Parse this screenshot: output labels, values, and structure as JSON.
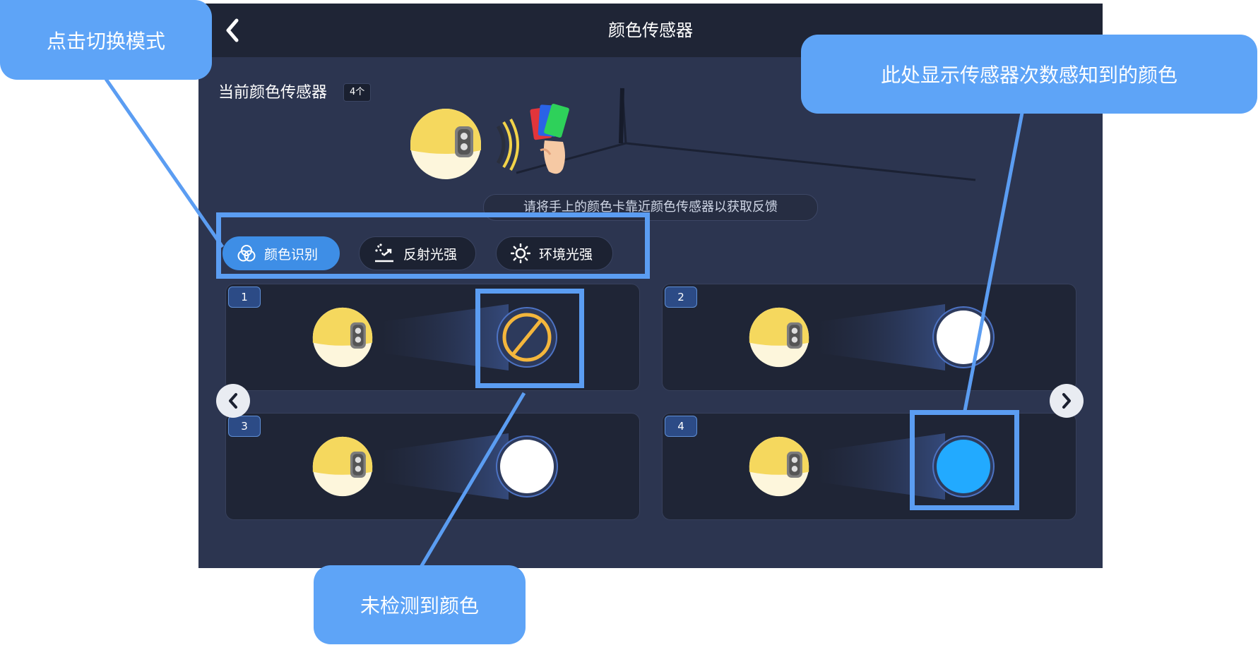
{
  "header": {
    "title": "颜色传感器",
    "back_icon": "chevron-left-icon"
  },
  "sensor": {
    "label": "当前颜色传感器",
    "count": "4个"
  },
  "hint": "请将手上的颜色卡靠近颜色传感器以获取反馈",
  "modes": [
    {
      "label": "颜色识别",
      "icon": "color-circles-icon",
      "active": true
    },
    {
      "label": "反射光强",
      "icon": "reflection-icon",
      "active": false
    },
    {
      "label": "环境光强",
      "icon": "sun-icon",
      "active": false
    }
  ],
  "cards": [
    {
      "number": "1",
      "detected": "none",
      "color": null
    },
    {
      "number": "2",
      "detected": "white",
      "color": "#ffffff"
    },
    {
      "number": "3",
      "detected": "white",
      "color": "#ffffff"
    },
    {
      "number": "4",
      "detected": "blue",
      "color": "#22aaff"
    }
  ],
  "callouts": {
    "switch_mode": "点击切换模式",
    "sensed_color": "此处显示传感器次数感知到的颜色",
    "no_color": "未检测到颜色"
  },
  "colors": {
    "accent": "#5ea4f7",
    "active_mode": "#3e8ee6",
    "screen_bg": "#2c3550",
    "sensor_yellow": "#f5d85e",
    "no_color_ring": "#f4b63c"
  }
}
